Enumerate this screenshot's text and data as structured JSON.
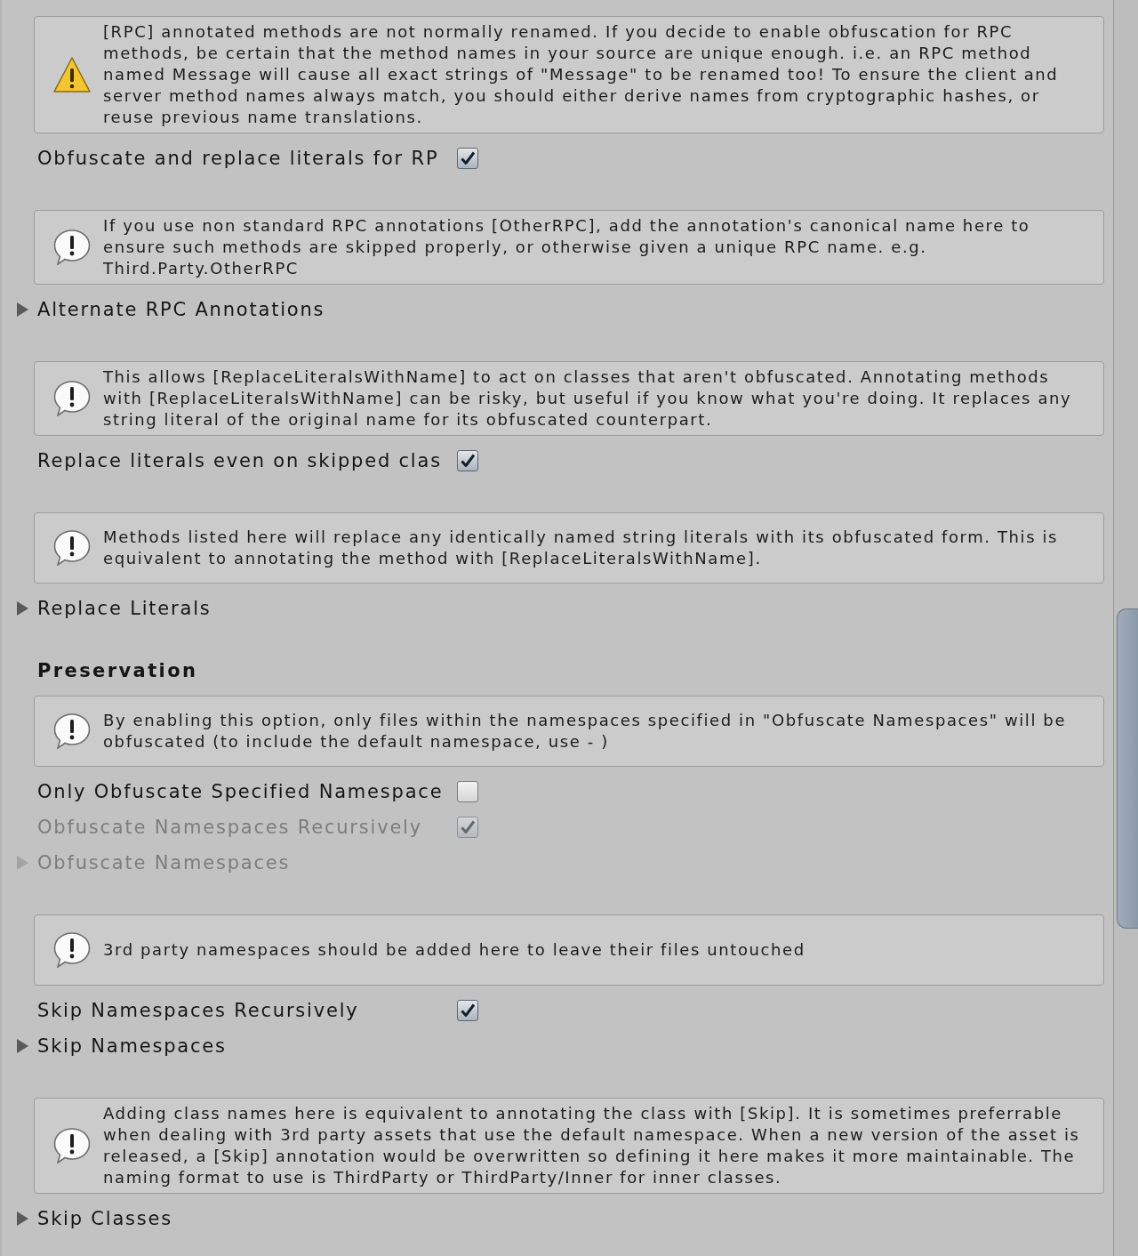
{
  "inspector": {
    "items": [
      {
        "kind": "warning",
        "text": "[RPC] annotated methods are not normally renamed. If you decide to enable obfuscation for RPC methods, be certain that the method names in your source are unique enough. i.e. an RPC method named Message will cause all exact strings of \"Message\" to be renamed too! To ensure the client and server method names always match, you should either derive names from cryptographic hashes, or reuse previous name translations."
      },
      {
        "kind": "toggle",
        "label": "Obfuscate and replace literals for RP",
        "checked": true,
        "disabled": false
      },
      {
        "kind": "info",
        "text": "If you use non standard RPC annotations [OtherRPC], add the annotation's canonical name here to ensure such methods are skipped properly, or otherwise given a unique RPC name. e.g. Third.Party.OtherRPC"
      },
      {
        "kind": "foldout",
        "label": "Alternate RPC Annotations",
        "expanded": false,
        "disabled": false
      },
      {
        "kind": "info",
        "text": "This allows [ReplaceLiteralsWithName] to act on classes that aren't obfuscated. Annotating methods with [ReplaceLiteralsWithName] can be risky, but useful if you know what you're doing. It replaces any string literal of the original name for its obfuscated counterpart."
      },
      {
        "kind": "toggle",
        "label": "Replace literals even on skipped clas",
        "checked": true,
        "disabled": false
      },
      {
        "kind": "info",
        "text": "Methods listed here will replace any identically named string literals with its obfuscated form. This is equivalent to annotating the method with [ReplaceLiteralsWithName]."
      },
      {
        "kind": "foldout",
        "label": "Replace Literals",
        "expanded": false,
        "disabled": false
      },
      {
        "kind": "heading",
        "label": "Preservation"
      },
      {
        "kind": "info",
        "text": "By enabling this option, only files within the namespaces specified in \"Obfuscate Namespaces\" will be obfuscated (to include the default namespace, use - )"
      },
      {
        "kind": "toggle",
        "label": "Only Obfuscate Specified Namespace",
        "checked": false,
        "disabled": false
      },
      {
        "kind": "toggle",
        "label": "Obfuscate Namespaces Recursively",
        "checked": true,
        "disabled": true
      },
      {
        "kind": "foldout",
        "label": "Obfuscate Namespaces",
        "expanded": false,
        "disabled": true
      },
      {
        "kind": "info",
        "text": "3rd party namespaces should be added here to leave their files untouched"
      },
      {
        "kind": "toggle",
        "label": "Skip Namespaces Recursively",
        "checked": true,
        "disabled": false
      },
      {
        "kind": "foldout",
        "label": "Skip Namespaces",
        "expanded": false,
        "disabled": false
      },
      {
        "kind": "info",
        "text": "Adding class names here is equivalent to annotating the class with [Skip]. It is sometimes preferrable when dealing with 3rd party assets that use the default namespace. When a new version of the asset is released, a [Skip] annotation would be overwritten so defining it here makes it more maintainable. The naming format to use is ThirdParty or ThirdParty/Inner for inner classes."
      },
      {
        "kind": "foldout",
        "label": "Skip Classes",
        "expanded": false,
        "disabled": false
      }
    ]
  }
}
